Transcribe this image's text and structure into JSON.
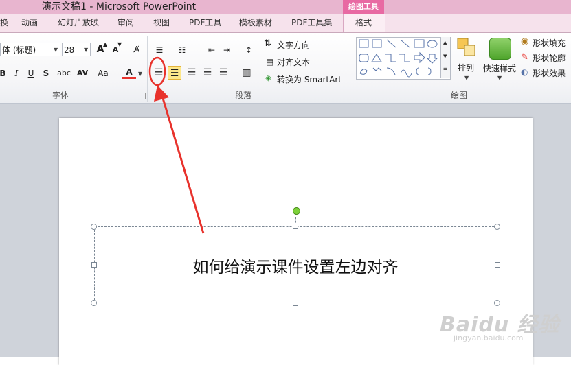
{
  "window": {
    "title": "演示文稿1 - Microsoft PowerPoint"
  },
  "context_tab_group": "绘图工具",
  "tabs": [
    {
      "label": "换"
    },
    {
      "label": "动画"
    },
    {
      "label": "幻灯片放映"
    },
    {
      "label": "审阅"
    },
    {
      "label": "视图"
    },
    {
      "label": "PDF工具"
    },
    {
      "label": "模板素材"
    },
    {
      "label": "PDF工具集"
    },
    {
      "label": "格式"
    }
  ],
  "font_group": {
    "label": "字体",
    "font_name": "体 (标题)",
    "font_size": "28",
    "grow_font": "A",
    "shrink_font": "A",
    "bold": "B",
    "italic": "I",
    "underline": "U",
    "shadow": "S",
    "strike": "abc",
    "spacing": "AV",
    "change_case": "Aa",
    "font_color": "A"
  },
  "paragraph_group": {
    "label": "段落",
    "text_direction": "文字方向",
    "align_text": "对齐文本",
    "convert_smartart": "转换为 SmartArt"
  },
  "drawing_group": {
    "label": "绘图",
    "arrange": "排列",
    "quick_styles": "快速样式",
    "shape_fill": "形状填充",
    "shape_outline": "形状轮廓",
    "shape_effects": "形状效果"
  },
  "slide": {
    "text": "如何给演示课件设置左边对齐"
  },
  "watermark": {
    "main": "Baidu 经验",
    "sub": "jingyan.baidu.com"
  },
  "colors": {
    "title_bar": "#e8b5cf",
    "context_header": "#e86aa3",
    "selected_button": "#fde78a",
    "annotation": "#e8322c",
    "rotate_handle": "#7dd13a"
  }
}
